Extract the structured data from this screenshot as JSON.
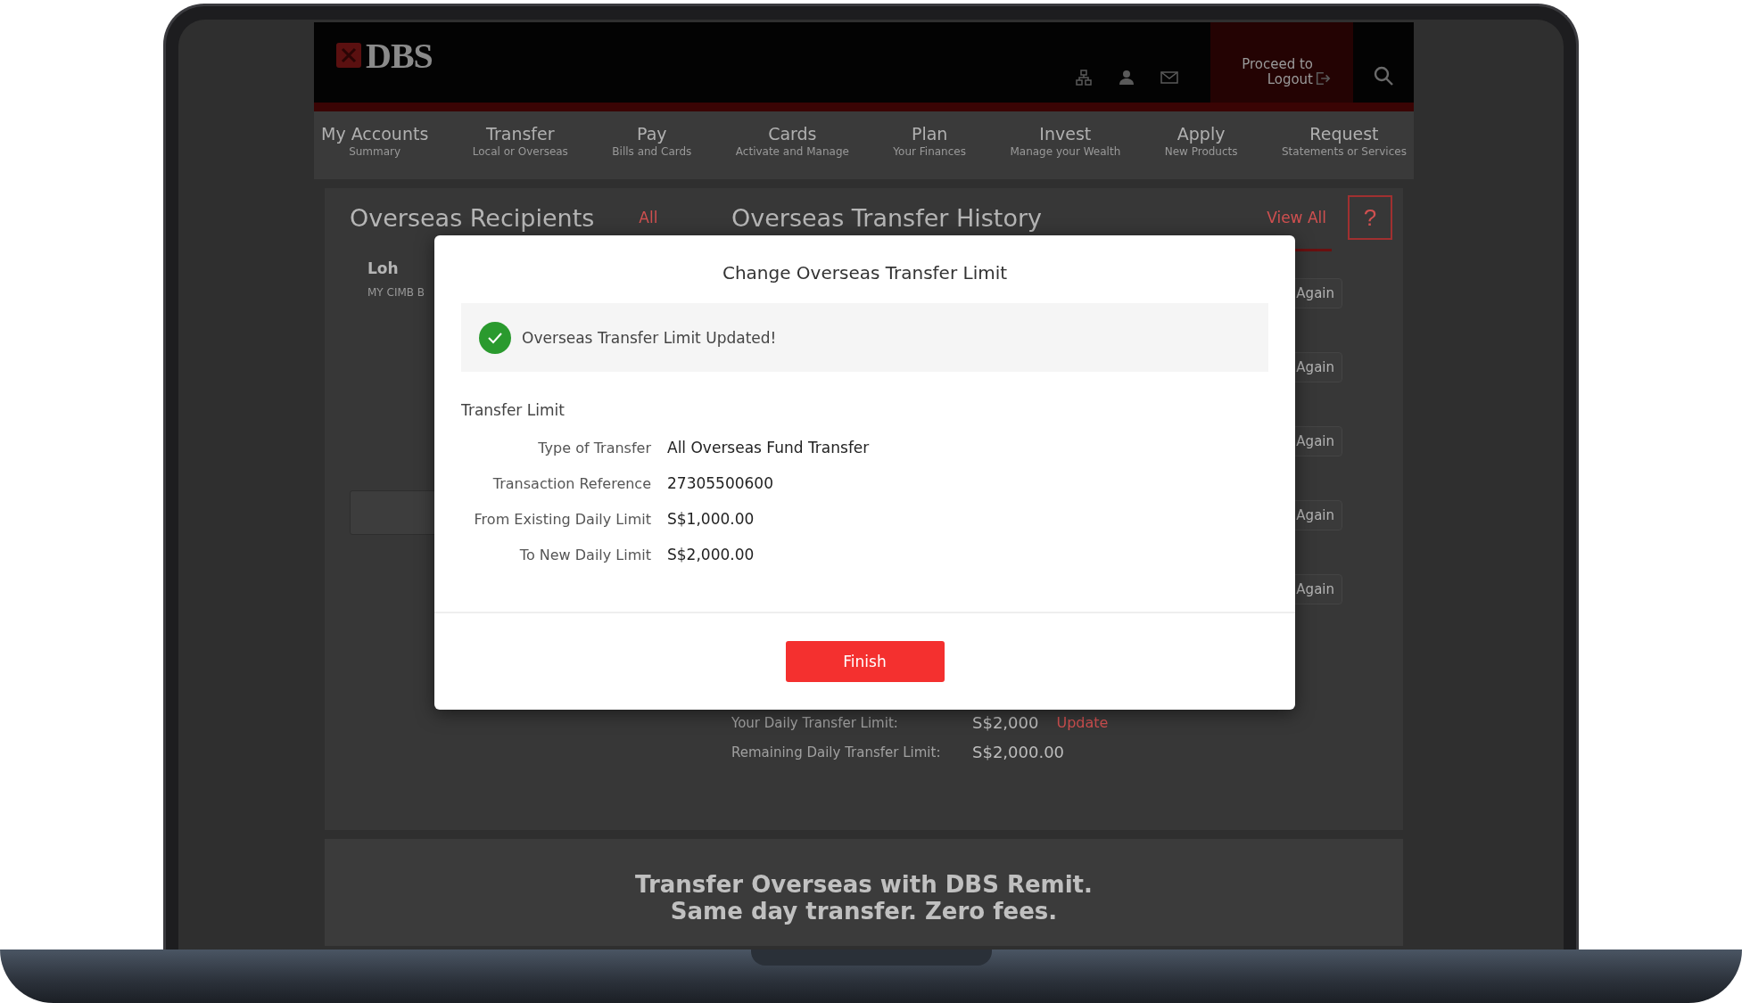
{
  "header": {
    "logo": "DBS",
    "logout_button": "Proceed to Logout"
  },
  "nav": [
    {
      "label": "My Accounts",
      "sublabel": "Summary"
    },
    {
      "label": "Transfer",
      "sublabel": "Local or Overseas"
    },
    {
      "label": "Pay",
      "sublabel": "Bills and Cards"
    },
    {
      "label": "Cards",
      "sublabel": "Activate and Manage"
    },
    {
      "label": "Plan",
      "sublabel": "Your Finances"
    },
    {
      "label": "Invest",
      "sublabel": "Manage your Wealth"
    },
    {
      "label": "Apply",
      "sublabel": "New Products"
    },
    {
      "label": "Request",
      "sublabel": "Statements or Services"
    }
  ],
  "recipients": {
    "title": "Overseas Recipients",
    "link": "All",
    "items": [
      {
        "name": "Loh",
        "detail": "MY CIMB B"
      }
    ]
  },
  "history": {
    "title": "Overseas Transfer History",
    "link": "View All",
    "help_button": "?",
    "again_buttons": [
      "Again",
      "Again",
      "Again",
      "Again",
      "Again"
    ]
  },
  "limit_summary": [
    {
      "label": "Your Daily Transfer Limit:",
      "value": "S$2,000",
      "action": "Update"
    },
    {
      "label": "Remaining Daily Transfer Limit:",
      "value": "S$2,000.00"
    }
  ],
  "banner": {
    "lines": [
      "Transfer Overseas with DBS Remit.",
      "Same day transfer. Zero fees."
    ]
  },
  "modal": {
    "title": "Change Overseas Transfer Limit",
    "success_message": "Overseas Transfer Limit Updated!",
    "section_title": "Transfer Limit",
    "rows": [
      {
        "label": "Type of Transfer",
        "value": "All Overseas Fund Transfer"
      },
      {
        "label": "Transaction Reference",
        "value": "27305500600"
      },
      {
        "label": "From Existing Daily Limit",
        "value": "S$1,000.00"
      },
      {
        "label": "To New Daily Limit",
        "value": "S$2,000.00"
      }
    ],
    "button": "Finish"
  }
}
